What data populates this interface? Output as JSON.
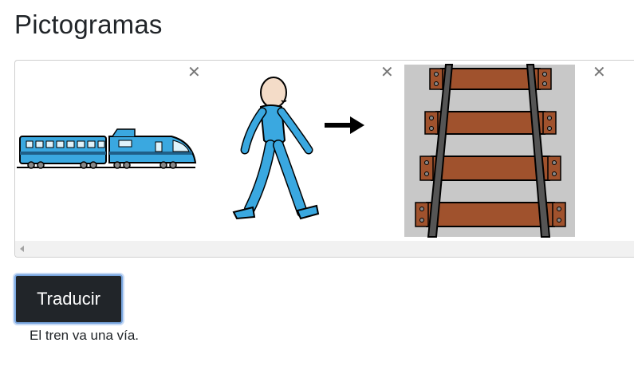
{
  "page": {
    "title": "Pictogramas"
  },
  "pictograms": [
    {
      "name": "train",
      "remove_icon": "✕"
    },
    {
      "name": "walk-to",
      "remove_icon": "✕"
    },
    {
      "name": "railway-track",
      "remove_icon": "✕"
    }
  ],
  "actions": {
    "translate_label": "Traducir"
  },
  "result": {
    "text": "El tren va una vía."
  },
  "colors": {
    "button_bg": "#212529",
    "focus_ring": "#7aa7e0",
    "train_blue": "#3aa8e0",
    "person_blue": "#3aa8e0",
    "sleeper_brown": "#a0522d",
    "rail_gray": "#555555"
  }
}
